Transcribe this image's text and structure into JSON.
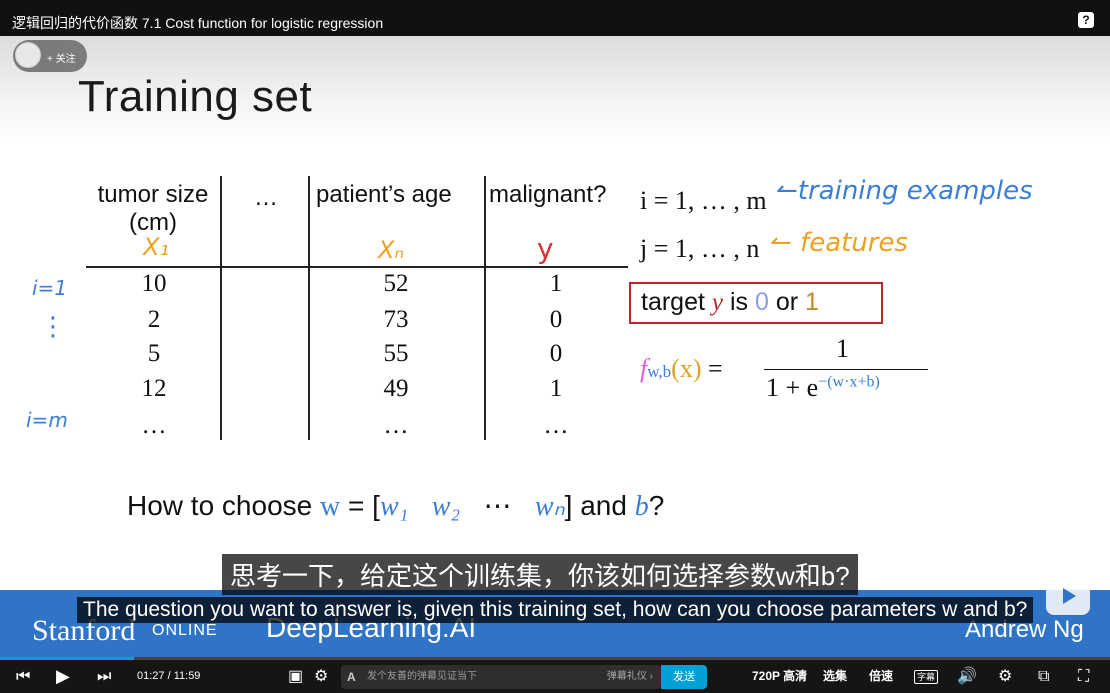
{
  "window": {
    "title": "逻辑回归的代价函数 7.1 Cost function for logistic regression",
    "help_icon": "?"
  },
  "uploader": {
    "follow_label": "+ 关注"
  },
  "slide": {
    "title": "Training set",
    "table": {
      "headers": [
        "tumor size\n(cm)",
        "…",
        "patient’s age",
        "malignant?"
      ],
      "hand_labels": {
        "x1": "X₁",
        "xn": "Xₙ",
        "y": "y"
      },
      "rows": [
        [
          "10",
          "52",
          "1"
        ],
        [
          "2",
          "73",
          "0"
        ],
        [
          "5",
          "55",
          "0"
        ],
        [
          "12",
          "49",
          "1"
        ],
        [
          "…",
          "…",
          "…"
        ]
      ],
      "row_marks": {
        "first": "i=1",
        "dots": "⋮",
        "last": "i=m"
      }
    },
    "notes": {
      "i_range": "i = 1, … , m",
      "i_hand": "↼training examples",
      "j_range": "j = 1, … , n",
      "j_hand": "↼ features",
      "target_prefix": "target",
      "target_y": "y",
      "target_is": "is",
      "target_zero": "0",
      "target_or": "or",
      "target_one": "1",
      "f_label": "f",
      "f_sub": "w,b",
      "f_x": "(x)",
      "equals": "=",
      "numerator": "1",
      "denominator": "1 + e",
      "exponent": "−(w·x+b)"
    },
    "question": {
      "prefix": "How to choose",
      "w": "w",
      "equals": "= [",
      "w1": "w₁",
      "w2": "w₂",
      "dots": "⋯",
      "wn": "wₙ",
      "suffix": "] and",
      "b": "b",
      "end": "?"
    }
  },
  "branding": {
    "stanford": "Stanford",
    "online": "ONLINE",
    "dla": "DeepLearning.AI",
    "andrew": "Andrew Ng"
  },
  "subtitles": {
    "zh": "思考一下，给定这个训练集，你该如何选择参数w和b?",
    "en": "The question you want to answer is, given this training set, how can you choose parameters w and b?"
  },
  "player": {
    "time_current": "01:27",
    "time_sep": "/",
    "time_total": "11:59",
    "progress": 0.121,
    "danmaku_placeholder": "发个友善的弹幕见证当下",
    "danmaku_etiquette": "弹幕礼仪 ›",
    "send_label": "发送",
    "quality": "720P 高清",
    "episodes": "选集",
    "speed": "倍速",
    "subtitle_badge": "字幕",
    "accent_color": "#00a1d6"
  }
}
